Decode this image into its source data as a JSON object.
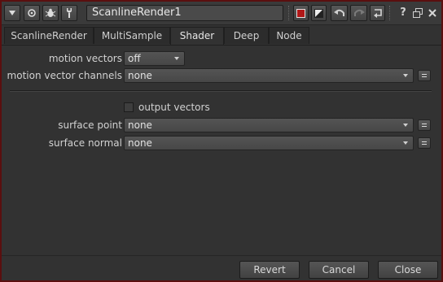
{
  "node": {
    "name": "ScanlineRender1"
  },
  "toolbar": {
    "icons": [
      "collapse-arrow-icon",
      "circle-icon",
      "bug-icon",
      "wrench-icon",
      "red-square-icon",
      "color-swatch-icon",
      "undo-icon",
      "redo-icon",
      "revert-icon",
      "help-icon",
      "float-icon",
      "close-icon"
    ],
    "help": "?"
  },
  "tabs": [
    {
      "label": "ScanlineRender",
      "active": false
    },
    {
      "label": "MultiSample",
      "active": false
    },
    {
      "label": "Shader",
      "active": true
    },
    {
      "label": "Deep",
      "active": false
    },
    {
      "label": "Node",
      "active": false
    }
  ],
  "shader": {
    "motion_vectors": {
      "label": "motion vectors",
      "value": "off"
    },
    "motion_vector_channels": {
      "label": "motion vector channels",
      "value": "none"
    },
    "output_vectors": {
      "label": "output vectors",
      "checked": false
    },
    "surface_point": {
      "label": "surface point",
      "value": "none"
    },
    "surface_normal": {
      "label": "surface normal",
      "value": "none"
    }
  },
  "buttons": {
    "revert": "Revert",
    "cancel": "Cancel",
    "close": "Close"
  },
  "colors": {
    "frame": "#5a0f0f",
    "panel": "#323232",
    "accent_red": "#b01818"
  }
}
